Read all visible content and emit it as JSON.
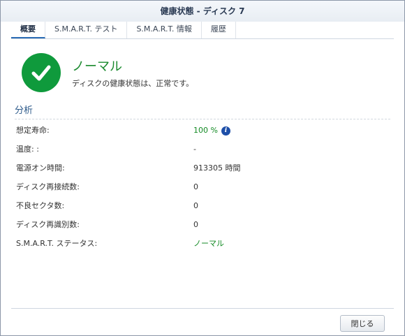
{
  "window": {
    "title": "健康状態 - ディスク 7"
  },
  "tabs": [
    {
      "label": "概要",
      "active": true
    },
    {
      "label": "S.M.A.R.T. テスト",
      "active": false
    },
    {
      "label": "S.M.A.R.T. 情報",
      "active": false
    },
    {
      "label": "履歴",
      "active": false
    }
  ],
  "status": {
    "title": "ノーマル",
    "description": "ディスクの健康状態は、正常です。",
    "icon": "check-icon",
    "color": "#0f9a3c"
  },
  "analysis": {
    "heading": "分析",
    "rows": [
      {
        "label": "想定寿命:",
        "value": "100 %"
      },
      {
        "label": "温度: :",
        "value": "-"
      },
      {
        "label": "電源オン時間:",
        "value": "913305 時間"
      },
      {
        "label": "ディスク再接続数:",
        "value": "0"
      },
      {
        "label": "不良セクタ数:",
        "value": "0"
      },
      {
        "label": "ディスク再識別数:",
        "value": "0"
      },
      {
        "label": "S.M.A.R.T. ステータス:",
        "value": "ノーマル"
      }
    ]
  },
  "footer": {
    "close_label": "閉じる"
  }
}
